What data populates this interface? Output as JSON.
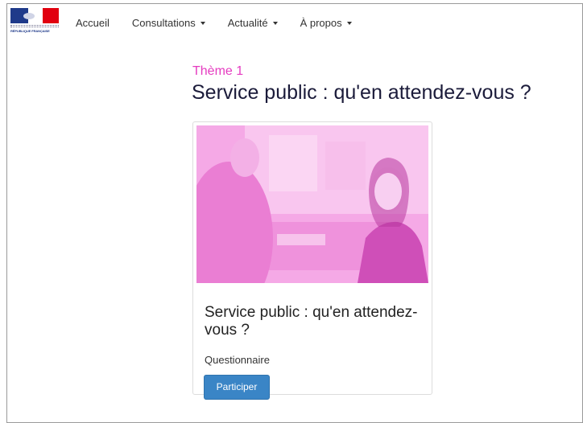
{
  "logo": {
    "text": "RÉPUBLIQUE FRANÇAISE",
    "motto": "Liberté • Égalité • Fraternité",
    "colors": {
      "blue": "#1f3a8a",
      "white": "#ffffff",
      "red": "#e1000f"
    }
  },
  "nav": {
    "items": [
      {
        "label": "Accueil",
        "dropdown": false
      },
      {
        "label": "Consultations",
        "dropdown": true
      },
      {
        "label": "Actualité",
        "dropdown": true
      },
      {
        "label": "À propos",
        "dropdown": true
      }
    ]
  },
  "header": {
    "theme_label": "Thème 1",
    "title": "Service public : qu'en attendez-vous ?"
  },
  "card": {
    "image_icon": "photo-icon",
    "title": "Service public : qu'en attendez-vous ?",
    "type": "Questionnaire",
    "button_label": "Participer"
  },
  "colors": {
    "theme_accent": "#e53bc0",
    "title_color": "#1b1b3a",
    "button": "#3a85c6",
    "image_tint": "#f29ce0"
  }
}
